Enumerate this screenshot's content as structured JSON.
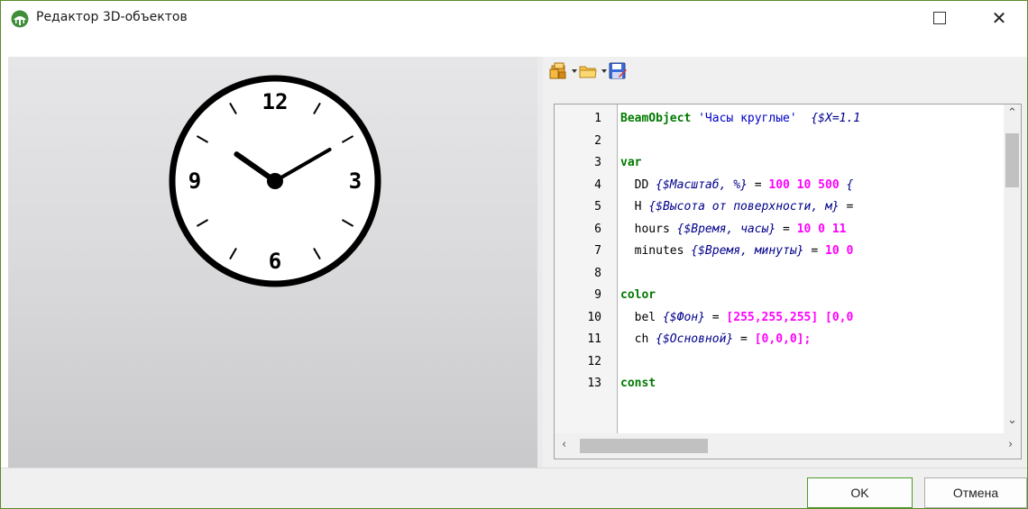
{
  "window": {
    "title": "Редактор 3D-объектов",
    "app_icon": "tree-dome-icon",
    "accent_color": "#4c9a2a"
  },
  "preview": {
    "object": "clock",
    "clock_numerals": [
      "12",
      "3",
      "6",
      "9"
    ],
    "hours": 10,
    "minutes": 10
  },
  "toolbar": {
    "items": [
      {
        "icon": "templates-icon",
        "has_dropdown": true
      },
      {
        "icon": "open-folder-icon",
        "has_dropdown": true
      },
      {
        "icon": "save-icon",
        "has_dropdown": false
      }
    ]
  },
  "editor": {
    "lines": [
      {
        "n": "1",
        "tokens": [
          {
            "t": "kw",
            "v": "BeamObject"
          },
          {
            "t": "plain",
            "v": " "
          },
          {
            "t": "str",
            "v": "'Часы круглые'"
          },
          {
            "t": "plain",
            "v": "  "
          },
          {
            "t": "cm",
            "v": "{$X=1.1"
          }
        ]
      },
      {
        "n": "2",
        "tokens": []
      },
      {
        "n": "3",
        "tokens": [
          {
            "t": "kw",
            "v": "var"
          }
        ]
      },
      {
        "n": "4",
        "tokens": [
          {
            "t": "plain",
            "v": "  DD "
          },
          {
            "t": "cm",
            "v": "{$Масштаб, %}"
          },
          {
            "t": "plain",
            "v": " = "
          },
          {
            "t": "num",
            "v": "100 10 500"
          },
          {
            "t": "plain",
            "v": " "
          },
          {
            "t": "cm",
            "v": "{"
          }
        ]
      },
      {
        "n": "5",
        "tokens": [
          {
            "t": "plain",
            "v": "  H "
          },
          {
            "t": "cm",
            "v": "{$Высота от поверхности, м}"
          },
          {
            "t": "plain",
            "v": " ="
          }
        ]
      },
      {
        "n": "6",
        "tokens": [
          {
            "t": "plain",
            "v": "  hours "
          },
          {
            "t": "cm",
            "v": "{$Время, часы}"
          },
          {
            "t": "plain",
            "v": " = "
          },
          {
            "t": "num",
            "v": "10 0 11"
          }
        ]
      },
      {
        "n": "7",
        "tokens": [
          {
            "t": "plain",
            "v": "  minutes "
          },
          {
            "t": "cm",
            "v": "{$Время, минуты}"
          },
          {
            "t": "plain",
            "v": " = "
          },
          {
            "t": "num",
            "v": "10 0"
          }
        ]
      },
      {
        "n": "8",
        "tokens": []
      },
      {
        "n": "9",
        "tokens": [
          {
            "t": "kw",
            "v": "color"
          }
        ]
      },
      {
        "n": "10",
        "tokens": [
          {
            "t": "plain",
            "v": "  bel "
          },
          {
            "t": "cm",
            "v": "{$Фон}"
          },
          {
            "t": "plain",
            "v": " = "
          },
          {
            "t": "num",
            "v": "[255,255,255] [0,0"
          }
        ]
      },
      {
        "n": "11",
        "tokens": [
          {
            "t": "plain",
            "v": "  ch "
          },
          {
            "t": "cm",
            "v": "{$Основной}"
          },
          {
            "t": "plain",
            "v": " = "
          },
          {
            "t": "num",
            "v": "[0,0,0];"
          }
        ]
      },
      {
        "n": "12",
        "tokens": []
      },
      {
        "n": "13",
        "tokens": [
          {
            "t": "kw",
            "v": "const"
          }
        ]
      }
    ],
    "vscroll_position": 0.08,
    "hscroll_position": 0.0
  },
  "buttons": {
    "ok_label": "OK",
    "cancel_label": "Отмена"
  }
}
